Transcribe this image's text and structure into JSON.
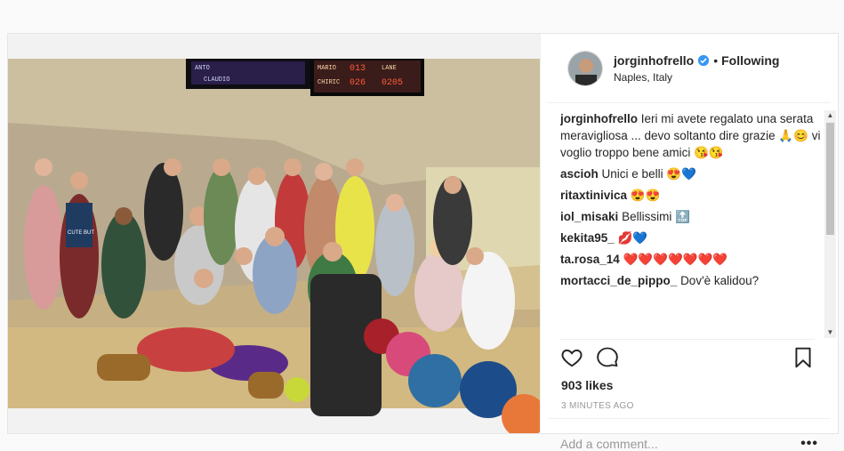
{
  "post": {
    "username": "jorginhofrello",
    "following_label": "Following",
    "location": "Naples, Italy",
    "likes": "903 likes",
    "timestamp": "3 MINUTES AGO",
    "comment_placeholder": "Add a comment...",
    "more_label": "•••"
  },
  "photo": {
    "scoreboard_left": [
      "ANTO",
      "CLAUDIO"
    ],
    "scoreboard_right": [
      "MARIO",
      "013",
      "LANE",
      "CHIRIC",
      "026",
      "0205"
    ],
    "shirt_text": "CUTE BUT"
  },
  "comments": [
    {
      "user": "jorginhofrello",
      "text": "Ieri mi avete regalato una serata meravigliosa ... devo soltanto dire grazie 🙏😊 vi voglio troppo bene amici 😘😘"
    },
    {
      "user": "ascioh",
      "text": "Unici e belli",
      "emoji": "😍💙"
    },
    {
      "user": "ritaxtinivica",
      "text": "",
      "emoji": "😍😍"
    },
    {
      "user": "iol_misaki",
      "text": "Bellissimi",
      "emoji": "🔝"
    },
    {
      "user": "kekita95_",
      "text": "",
      "emoji": "💋💙"
    },
    {
      "user": "ta.rosa_14",
      "text": "",
      "emoji": "❤️❤️❤️❤️❤️❤️❤️"
    },
    {
      "user": "mortacci_de_pippo_",
      "text": "Dov'è kalidou?"
    }
  ],
  "icons": {
    "like": "heart-outline-icon",
    "comment": "comment-bubble-icon",
    "save": "bookmark-icon",
    "verified": "verified-badge-icon"
  },
  "colors": {
    "verified": "#3897f0",
    "heart": "#ed4956",
    "border": "#efefef"
  }
}
